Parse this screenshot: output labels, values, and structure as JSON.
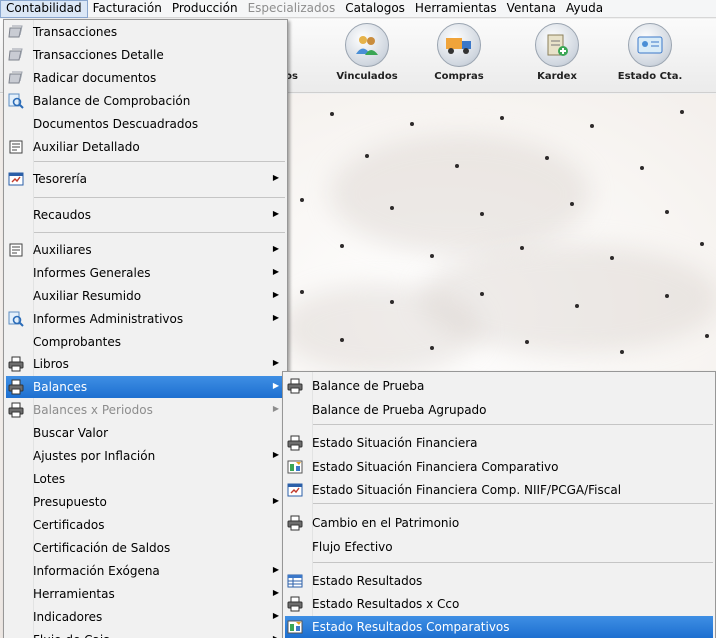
{
  "menubar": {
    "items": [
      {
        "label": "Contabilidad",
        "state": "open"
      },
      {
        "label": "Facturación",
        "state": "normal"
      },
      {
        "label": "Producción",
        "state": "normal"
      },
      {
        "label": "Especializados",
        "state": "disabled"
      },
      {
        "label": "Catalogos",
        "state": "normal"
      },
      {
        "label": "Herramientas",
        "state": "normal"
      },
      {
        "label": "Ventana",
        "state": "normal"
      },
      {
        "label": "Ayuda",
        "state": "normal"
      }
    ]
  },
  "toolbar": {
    "buttons": [
      {
        "label": "tos",
        "icon": "partial-icon"
      },
      {
        "label": "Vinculados",
        "icon": "people-icon"
      },
      {
        "label": "Compras",
        "icon": "truck-icon"
      },
      {
        "label": "Kardex",
        "icon": "clipboard-add-icon"
      },
      {
        "label": "Estado Cta.",
        "icon": "id-card-icon"
      }
    ]
  },
  "menu_contabilidad": {
    "items": [
      {
        "label": "Transacciones",
        "icon": "ledger-icon"
      },
      {
        "label": "Transacciones Detalle",
        "icon": "ledger-icon"
      },
      {
        "label": "Radicar documentos",
        "icon": "ledger-icon"
      },
      {
        "label": "Balance de Comprobación",
        "icon": "magnifier-icon"
      },
      {
        "label": "Documentos Descuadrados"
      },
      {
        "label": "Auxiliar Detallado",
        "icon": "report-icon"
      },
      {
        "label": "Tesorería",
        "icon": "window-icon",
        "submenu": true
      },
      {
        "label": "Recaudos",
        "submenu": true
      },
      {
        "label": "Auxiliares",
        "icon": "report-icon",
        "submenu": true
      },
      {
        "label": "Informes Generales",
        "submenu": true
      },
      {
        "label": "Auxiliar Resumido",
        "submenu": true
      },
      {
        "label": "Informes Administrativos",
        "icon": "magnifier-icon",
        "submenu": true
      },
      {
        "label": "Comprobantes"
      },
      {
        "label": "Libros",
        "icon": "printer-icon",
        "submenu": true
      },
      {
        "label": "Balances",
        "icon": "printer-icon",
        "submenu": true,
        "selected": true
      },
      {
        "label": "Balances x Periodos",
        "icon": "printer-icon",
        "submenu": true,
        "disabled": true
      },
      {
        "label": "Buscar Valor"
      },
      {
        "label": "Ajustes por Inflación",
        "submenu": true
      },
      {
        "label": "Lotes"
      },
      {
        "label": "Presupuesto",
        "submenu": true
      },
      {
        "label": "Certificados"
      },
      {
        "label": "Certificación de Saldos"
      },
      {
        "label": "Información Exógena",
        "submenu": true
      },
      {
        "label": "Herramientas",
        "submenu": true
      },
      {
        "label": "Indicadores",
        "submenu": true
      },
      {
        "label": "Flujo de Caja",
        "submenu": true
      }
    ]
  },
  "menu_balances": {
    "items": [
      {
        "label": "Balance de Prueba",
        "icon": "printer-icon"
      },
      {
        "label": "Balance de Prueba Agrupado"
      },
      {
        "label": "Estado Situación Financiera",
        "icon": "printer-icon"
      },
      {
        "label": "Estado Situación Financiera Comparativo",
        "icon": "compare-icon"
      },
      {
        "label": "Estado Situación Financiera Comp. NIIF/PCGA/Fiscal",
        "icon": "window-icon"
      },
      {
        "label": "Cambio en el Patrimonio",
        "icon": "printer-icon"
      },
      {
        "label": "Flujo Efectivo"
      },
      {
        "label": "Estado Resultados",
        "icon": "table-icon"
      },
      {
        "label": "Estado Resultados x Cco",
        "icon": "printer-icon"
      },
      {
        "label": "Estado Resultados Comparativos",
        "icon": "compare-icon",
        "selected": true
      }
    ]
  },
  "colors": {
    "selection": "#1d6fd0",
    "menu_bg": "#f1f1f1"
  }
}
